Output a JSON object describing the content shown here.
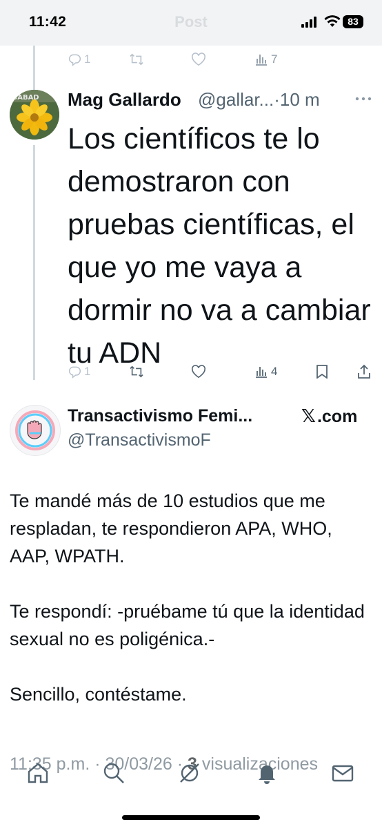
{
  "status_bar": {
    "time": "11:42",
    "nav_title": "Post",
    "battery": "83"
  },
  "prev_actions": {
    "replies": "1",
    "views": "7"
  },
  "tweet": {
    "author_name": "Mag Gallardo",
    "author_handle": "@gallar...",
    "time_sep": "·",
    "time": "10 m",
    "text": "Los científicos te lo demostraron con pruebas científicas, el que yo me vaya a dormir no va a cambiar tu ADN",
    "actions": {
      "replies": "1",
      "views": "4"
    }
  },
  "quote": {
    "author_name": "Transactivismo Femi...",
    "source": "x.com",
    "source_x": "𝕏",
    "source_rest": ".com",
    "author_handle": "@TransactivismoF",
    "paragraphs": [
      "Te mandé más de 10 estudios que me respladan, te respondieron APA, WHO, AAP, WPATH.",
      "Te respondí: -pruébame tú que la identidad sexual no es poligénica.-",
      "Sencillo, contéstame."
    ],
    "meta_time": "11:35 p.m. · 30/03/26 · ",
    "meta_views_count": "3",
    "meta_views_label": " visualizaciones"
  },
  "icons": [
    "reply-icon",
    "retweet-icon",
    "like-icon",
    "views-icon",
    "bookmark-icon",
    "share-icon",
    "more-icon",
    "home-icon",
    "search-icon",
    "grok-icon",
    "notifications-icon",
    "messages-icon"
  ]
}
